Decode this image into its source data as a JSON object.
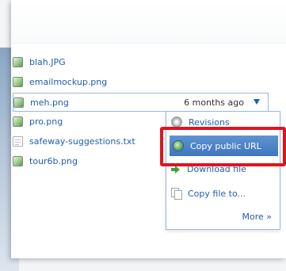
{
  "files": [
    {
      "name": "blah.JPG",
      "type": "image"
    },
    {
      "name": "emailmockup.png",
      "type": "image"
    },
    {
      "name": "pro.png",
      "type": "image"
    },
    {
      "name": "safeway-suggestions.txt",
      "type": "text"
    },
    {
      "name": "tour6b.png",
      "type": "image"
    }
  ],
  "selected_file": {
    "name": "meh.png",
    "modified": "6 months ago",
    "type": "image"
  },
  "context_menu": {
    "revisions": "Revisions",
    "copy_public_url": "Copy public URL",
    "download_file": "Download file",
    "copy_file_to": "Copy file to...",
    "more": "More »"
  },
  "icons": {
    "image_file": "image-file-icon",
    "text_file": "text-file-icon",
    "revisions": "revisions-icon",
    "public_url": "globe-icon",
    "download": "download-arrow-icon",
    "copy": "copy-files-icon",
    "dropdown": "dropdown-arrow-icon"
  },
  "colors": {
    "link": "#1f5fb0",
    "menu_highlight": "#4a80c6",
    "annotation_red": "#e0141e"
  }
}
